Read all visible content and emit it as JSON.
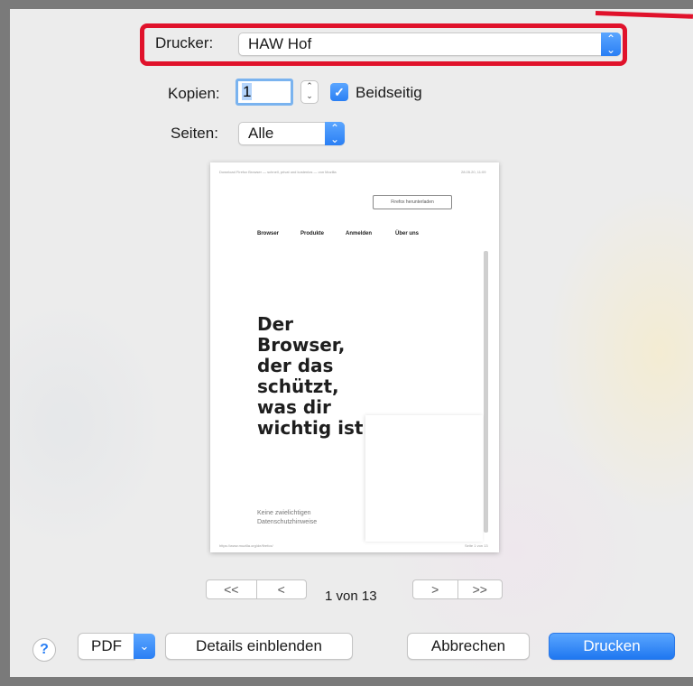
{
  "printer": {
    "label": "Drucker:",
    "value": "HAW Hof"
  },
  "copies": {
    "label": "Kopien:",
    "value": "1"
  },
  "duplex": {
    "label": "Beidseitig",
    "checked": true
  },
  "pages": {
    "label": "Seiten:",
    "value": "Alle"
  },
  "preview": {
    "header_left": "Download Firefox Browser — schnell, privat und kostenlos — von Mozilla",
    "header_right": "28.05.20, 11:09",
    "download_button": "Firefox herunterladen",
    "nav": [
      "Browser",
      "Produkte",
      "Anmelden",
      "Über uns"
    ],
    "headline": "Der Browser, der das schützt, was dir wichtig ist",
    "subtext": "Keine zwielichtigen Datenschutzhinweise",
    "footer_left": "https://www.mozilla.org/de/firefox/",
    "footer_right": "Seite 1 von 13"
  },
  "pagination": {
    "first": "<<",
    "prev": "<",
    "next": ">",
    "last": ">>",
    "indicator": "1 von 13"
  },
  "footer": {
    "help": "?",
    "pdf": "PDF",
    "details": "Details einblenden",
    "cancel": "Abbrechen",
    "print": "Drucken"
  },
  "colors": {
    "accent": "#2a7ff4",
    "highlight": "#e0122b"
  }
}
